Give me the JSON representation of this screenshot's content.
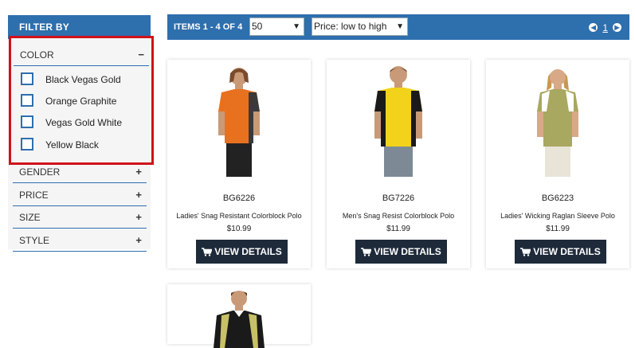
{
  "sidebar": {
    "title": "FILTER BY",
    "color_facet": {
      "label": "COLOR",
      "toggle": "−",
      "options": [
        "Black Vegas Gold",
        "Orange Graphite",
        "Vegas Gold White",
        "Yellow Black"
      ]
    },
    "facets": [
      {
        "label": "GENDER",
        "toggle": "+"
      },
      {
        "label": "PRICE",
        "toggle": "+"
      },
      {
        "label": "SIZE",
        "toggle": "+"
      },
      {
        "label": "STYLE",
        "toggle": "+"
      }
    ]
  },
  "toolbar": {
    "items_text": "ITEMS 1 - 4 OF 4",
    "per_page": "50",
    "sort": "Price: low to high",
    "page": "1"
  },
  "products": [
    {
      "sku": "BG6226",
      "name": "Ladies' Snag Resistant Colorblock Polo",
      "price": "$10.99",
      "button": "VIEW DETAILS"
    },
    {
      "sku": "BG7226",
      "name": "Men's Snag Resist Colorblock Polo",
      "price": "$11.99",
      "button": "VIEW DETAILS"
    },
    {
      "sku": "BG6223",
      "name": "Ladies' Wicking Raglan Sleeve Polo",
      "price": "$11.99",
      "button": "VIEW DETAILS"
    }
  ],
  "colors": {
    "accent": "#2e6fae",
    "highlight": "#d0121b",
    "button": "#1e2a3a"
  }
}
